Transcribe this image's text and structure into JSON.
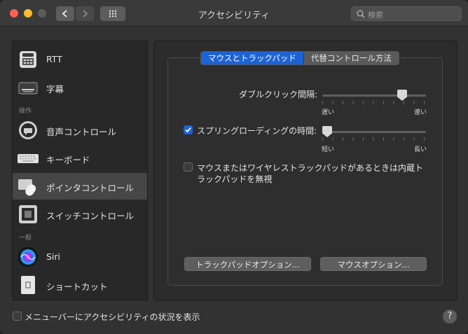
{
  "window": {
    "title": "アクセシビリティ",
    "search_placeholder": "検索",
    "help_label": "?"
  },
  "sidebar": {
    "items": [
      {
        "label": "RTT",
        "icon": "tty-phone-icon"
      },
      {
        "label": "字幕",
        "icon": "captions-icon"
      },
      {
        "label": "音声コントロール",
        "icon": "voice-control-icon"
      },
      {
        "label": "キーボード",
        "icon": "keyboard-icon"
      },
      {
        "label": "ポインタコントロール",
        "icon": "pointer-control-icon",
        "selected": true
      },
      {
        "label": "スイッチコントロール",
        "icon": "switch-control-icon"
      },
      {
        "label": "Siri",
        "icon": "siri-icon"
      },
      {
        "label": "ショートカット",
        "icon": "shortcut-icon"
      }
    ],
    "sections": {
      "motor": "操作",
      "general": "一般"
    }
  },
  "main": {
    "tabs": [
      {
        "label": "マウスとトラックパッド",
        "active": true
      },
      {
        "label": "代替コントロール方法",
        "active": false
      }
    ],
    "double_click": {
      "label": "ダブルクリック間隔:",
      "min_label": "遅い",
      "max_label": "速い",
      "value": 0.8
    },
    "spring_loading": {
      "label": "スプリングローディングの時間:",
      "checked": true,
      "min_label": "短い",
      "max_label": "長い",
      "value": 0.0
    },
    "ignore_trackpad": {
      "label_line1": "マウスまたはワイヤレストラックパッドがあるときは内蔵ト",
      "label_line2": "ラックパッドを無視",
      "checked": false
    },
    "trackpad_options_button": "トラックパッドオプション...",
    "mouse_options_button": "マウスオプション..."
  },
  "footer": {
    "show_in_menubar": {
      "label": "メニューバーにアクセシビリティの状況を表示",
      "checked": false
    }
  },
  "colors": {
    "accent": "#1c63d6",
    "background": "#323232"
  }
}
